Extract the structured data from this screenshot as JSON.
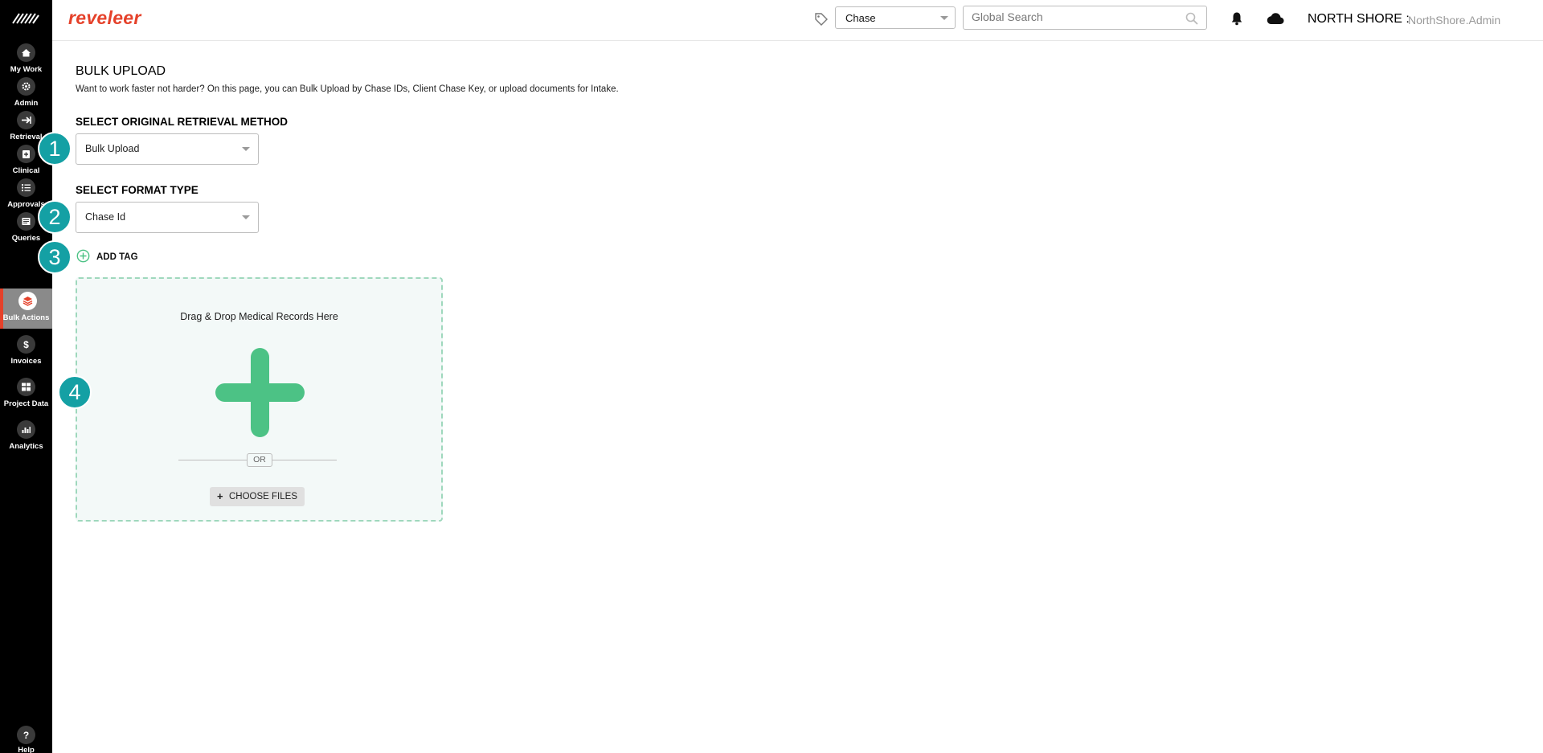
{
  "app": {
    "brand": "reveleer"
  },
  "sidebar": {
    "items": [
      {
        "label": "My Work",
        "icon": "home-icon"
      },
      {
        "label": "Admin",
        "icon": "admin-gear-icon"
      },
      {
        "label": "Retrieval",
        "icon": "arrow-right-icon"
      },
      {
        "label": "Clinical",
        "icon": "clinical-clipboard-icon"
      },
      {
        "label": "Approvals",
        "icon": "checklist-icon"
      },
      {
        "label": "Queries",
        "icon": "queries-list-icon"
      },
      {
        "label": "Bulk Actions",
        "icon": "layers-icon",
        "active": true
      },
      {
        "label": "Invoices",
        "icon": "dollar-icon"
      },
      {
        "label": "Project Data",
        "icon": "project-data-icon"
      },
      {
        "label": "Analytics",
        "icon": "bar-chart-icon"
      }
    ],
    "help_label": "Help"
  },
  "header": {
    "chase_select_value": "Chase",
    "search_placeholder": "Global Search",
    "org_name": "NORTH SHORE :",
    "user_name": "NorthShore.Admin"
  },
  "main": {
    "title": "BULK UPLOAD",
    "description": "Want to work faster not harder? On this page, you can Bulk Upload by Chase IDs, Client Chase Key, or upload documents for Intake.",
    "retrieval_label": "SELECT ORIGINAL RETRIEVAL METHOD",
    "retrieval_value": "Bulk Upload",
    "format_label": "SELECT FORMAT TYPE",
    "format_value": "Chase Id",
    "add_tag_label": "ADD TAG",
    "dropzone": {
      "title": "Drag & Drop Medical Records Here",
      "or_label": "OR",
      "choose_plus": "+",
      "choose_label": "CHOOSE FILES"
    }
  },
  "steps": [
    "1",
    "2",
    "3",
    "4"
  ],
  "colors": {
    "brand": "#e5412a",
    "sidebar_bg": "#000000",
    "active_nav": "#8a8a8a",
    "dropzone_border": "#9fd8bd",
    "dropzone_plus": "#4cc285",
    "step_marker": "#14a0a4"
  }
}
